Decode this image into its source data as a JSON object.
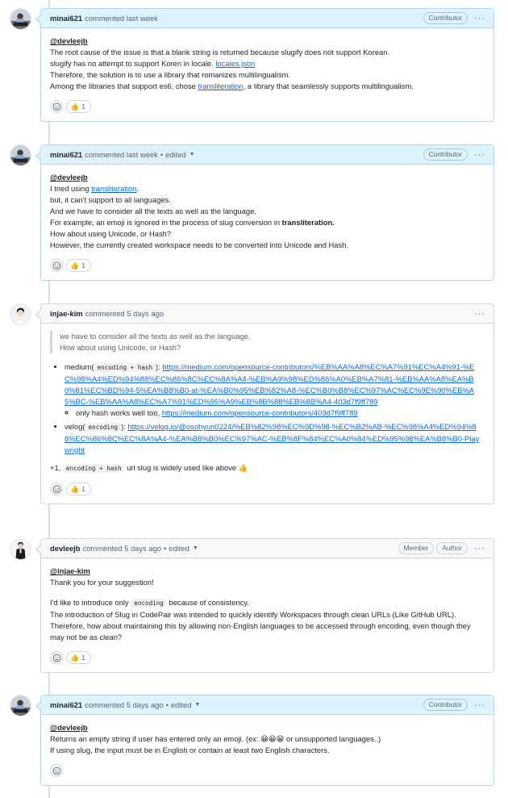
{
  "comments": [
    {
      "author": "minai621",
      "verb": "commented",
      "time": "last week",
      "edited": "",
      "badges": [
        "Contributor"
      ],
      "mention": "@devleejb",
      "lines": [
        "The root cause of the issue is that a blank string is returned because slugify does not support Korean.",
        "slugify has no attempt to support Koren in locale. ",
        "Therefore, the solution is to use a library that romanizes multilingualism.",
        "Among the libraries that support es6, chose "
      ],
      "link_locales": "locales.json",
      "link_transliteration": "transliteration",
      "line4_suffix": ", a library that seamlessly supports multilingualism.",
      "reaction_count": "1"
    },
    {
      "author": "minai621",
      "verb": "commented",
      "time": "last week",
      "edited": "edited",
      "badges": [
        "Contributor"
      ],
      "mention": "@devleejb",
      "line1_prefix": "I tried using ",
      "line1_link": "transliteration",
      "line1_suffix": ".",
      "line2": "but, it can't support to all languages.",
      "line3": "And we have to consider all the texts as well as the language.",
      "line4_prefix": "For example, an emoji is ignored in the process of slug conversion in ",
      "line4_bold": "transliteration.",
      "line5": "How about using Unicode, or Hash?",
      "line6": "However, the currently created workspace needs to be converted into Unicode and Hash.",
      "reaction_count": "1"
    },
    {
      "author": "injae-kim",
      "verb": "commented",
      "time": "5 days ago",
      "edited": "",
      "badges": [],
      "quote1": "we have to consider all the texts as well as the language.",
      "quote2": "How about using Unicode, or Hash?",
      "item1_prefix": "medium(",
      "item1_code": "encoding + hash",
      "item1_mid": "): ",
      "item1_link": "https://medium.com/opensource-contributors/%EB%AA%A8%EC%A7%91%EC%A4%91-%EC%98%A4%ED%94%88%EC%86%8C%EC%8A%A4-%EB%A9%98%ED%86%A0%EB%A7%81-%EB%AA%A8%EA%B0%81%EC%BD%94-5%EA%B8%B0-at-%EA%B0%95%EB%82%A8-%EC%B0%B8%EC%97%AC%EC%9E%90%EB%A5%BC-%EB%AA%A8%EC%A7%91%ED%95%A9%EB%8B%88%EB%8B%A4-403d7f9ff789",
      "subitem_prefix": "only hash works well too, ",
      "subitem_link": "https://medium.com/opensource-contributors/403d7f9ff789",
      "item2_prefix": "velog(",
      "item2_code": "encoding",
      "item2_mid": "): ",
      "item2_link": "https://velog.io/@osohyun0224/%EB%82%98%EC%9D%98-%EC%B2%AB-%EC%98%A4%ED%94%88%EC%86%8C%EC%8A%A4-%EA%B8%B0%EC%97%AC-%EB%8F%84%EC%A0%84%ED%95%98%EA%B8%B0-Playwright",
      "footer_prefix": "+1, ",
      "footer_code": "encoding + hash",
      "footer_suffix": " url slug is widely used like above ",
      "footer_emoji": "👍",
      "reaction_count": "1"
    },
    {
      "author": "devleejb",
      "verb": "commented",
      "time": "5 days ago",
      "edited": "edited",
      "badges": [
        "Member",
        "Author"
      ],
      "mention": "@injae-kim",
      "line1": "Thank you for your suggestion!",
      "line2_prefix": "I'd like to introduce only ",
      "line2_code": "encoding",
      "line2_suffix": " because of consistency.",
      "line3": "The introduction of Slug in CodePair was intended to quickly identify Workspaces through clean URLs (Like GitHub URL).",
      "line4": "Therefore, how about maintaining this by allowing non-English languages to be accessed through encoding, even though they may not be as clean?",
      "reaction_count": "1"
    },
    {
      "author": "minai621",
      "verb": "commented",
      "time": "5 days ago",
      "edited": "edited",
      "badges": [
        "Contributor"
      ],
      "mention": "@devleejb",
      "line1": "Returns an empty string if user has entered only an emoji. (ex: 😀😀😀 or unsupported languages..)",
      "line2": "If using slug, the input must be in English or contain at least two English characters."
    }
  ],
  "ui": {
    "dot": "•",
    "caret": "▼",
    "more": "···",
    "thumbs_up": "👍"
  },
  "colors": {
    "link": "#0969da",
    "header_blue": "#ddf4ff",
    "header_gray": "#f6f8fa",
    "border_blue": "#b6d4f5",
    "border_gray": "#d0d7de"
  }
}
